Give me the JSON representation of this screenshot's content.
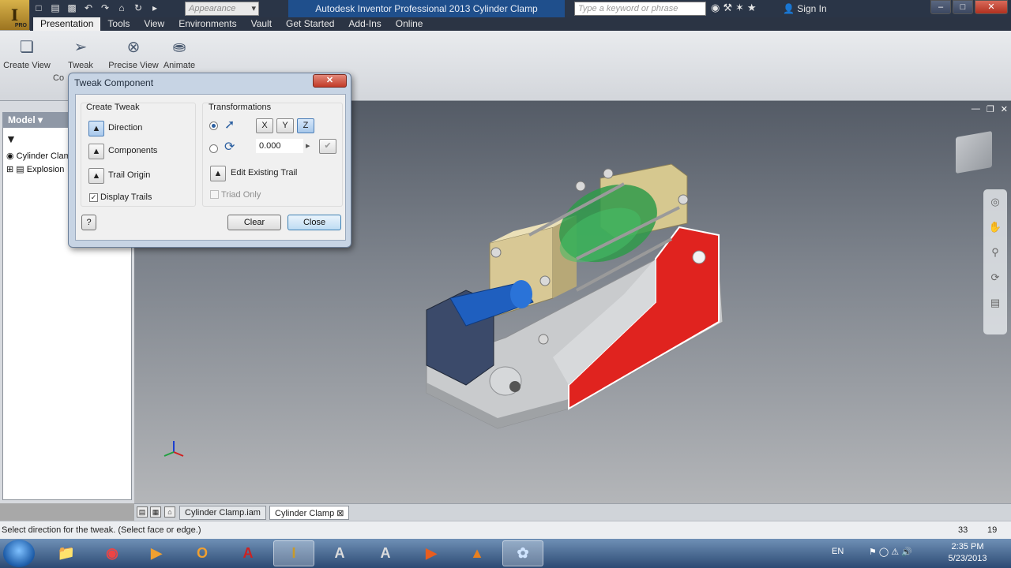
{
  "app": {
    "title": "Autodesk Inventor Professional 2013   Cylinder Clamp",
    "appearance_placeholder": "Appearance",
    "search_placeholder": "Type a keyword or phrase",
    "signin": "Sign In",
    "pro_badge": "PRO"
  },
  "menu": {
    "tabs": [
      "Presentation",
      "Tools",
      "View",
      "Environments",
      "Vault",
      "Get Started",
      "Add-Ins",
      "Online"
    ]
  },
  "ribbon": {
    "buttons": [
      "Create View",
      "Tweak",
      "Precise View",
      "Animate"
    ],
    "panel_label": "Co"
  },
  "browser": {
    "header": "Model ▾",
    "items": [
      "Cylinder Clam",
      "Explosion"
    ]
  },
  "dialog": {
    "title": "Tweak Component",
    "close_glyph": "✕",
    "create_tweak": {
      "title": "Create Tweak",
      "direction": "Direction",
      "components": "Components",
      "trail_origin": "Trail Origin",
      "display_trails": "Display Trails"
    },
    "transformations": {
      "title": "Transformations",
      "axes": [
        "X",
        "Y",
        "Z"
      ],
      "value": "0.000",
      "edit_trail": "Edit Existing Trail",
      "triad_only": "Triad Only"
    },
    "buttons": {
      "help": "?",
      "clear": "Clear",
      "close": "Close"
    }
  },
  "doc_tabs": [
    "Cylinder Clamp.iam",
    "Cylinder Clamp"
  ],
  "status": {
    "message": "Select direction for the tweak. (Select face or edge.)",
    "n1": "33",
    "n2": "19"
  },
  "taskbar": {
    "lang": "EN",
    "time": "2:35 PM",
    "date": "5/23/2013"
  },
  "colors": {
    "highlight_face": "#e0231f",
    "title_bar": "#1f4f8c"
  }
}
